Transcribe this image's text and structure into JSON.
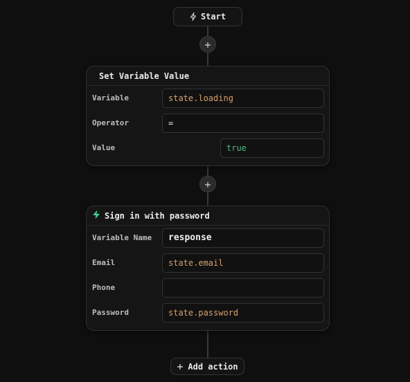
{
  "start_button": {
    "label": "Start",
    "icon": "lightning-icon"
  },
  "set_variable_card": {
    "title": "Set Variable Value",
    "rows": [
      {
        "label": "Variable",
        "value": "state.loading"
      },
      {
        "label": "Operator",
        "value": "="
      },
      {
        "label": "Value",
        "value": "true"
      }
    ]
  },
  "sign_in_card": {
    "title": "Sign in with password",
    "icon": "lightning-icon",
    "icon_color": "#3fcf8e",
    "rows": [
      {
        "label": "Variable Name",
        "value": "response"
      },
      {
        "label": "Email",
        "value": "state.email"
      },
      {
        "label": "Phone",
        "value": ""
      },
      {
        "label": "Password",
        "value": "state.password"
      }
    ]
  },
  "add_action_button": {
    "label": "Add action",
    "icon": "plus-icon"
  },
  "colors": {
    "background": "#0f0f0f",
    "expression": "#d8a06b",
    "boolean": "#4fb97c",
    "accent": "#3fcf8e"
  }
}
